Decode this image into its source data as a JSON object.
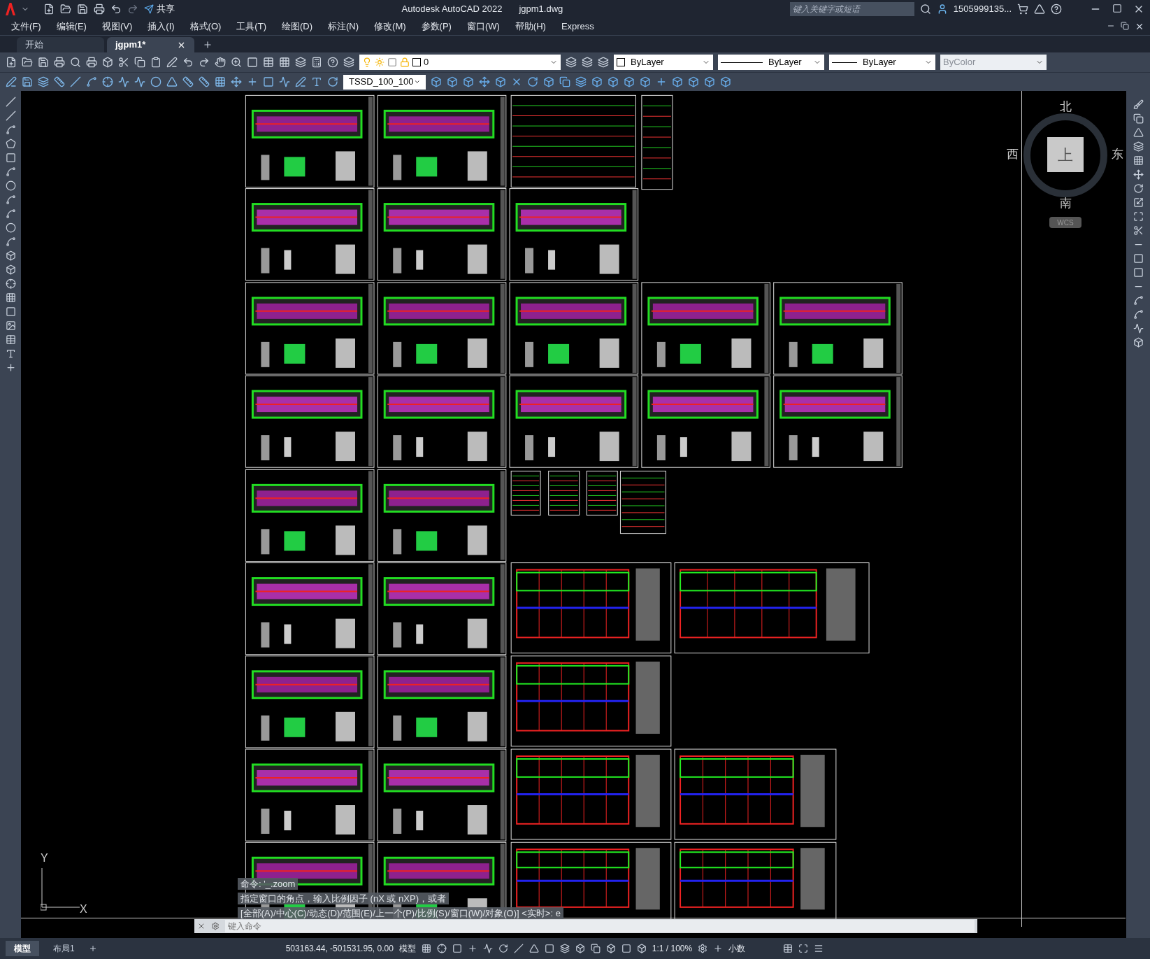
{
  "window": {
    "title": "Autodesk AutoCAD 2022",
    "file": "jgpm1.dwg",
    "share": "共享"
  },
  "search": {
    "placeholder": "键入关键字或短语"
  },
  "user": "1505999135...",
  "menu": [
    "文件(F)",
    "编辑(E)",
    "视图(V)",
    "插入(I)",
    "格式(O)",
    "工具(T)",
    "绘图(D)",
    "标注(N)",
    "修改(M)",
    "参数(P)",
    "窗口(W)",
    "帮助(H)",
    "Express"
  ],
  "file_tabs": [
    {
      "label": "开始",
      "selected": false
    },
    {
      "label": "jgpm1*",
      "selected": true
    }
  ],
  "layer": {
    "name": "0"
  },
  "text_style": {
    "value": "TSSD_100_100"
  },
  "properties": [
    {
      "kind": "color",
      "value": "ByLayer",
      "disabled": false
    },
    {
      "kind": "line",
      "value": "ByLayer",
      "disabled": false
    },
    {
      "kind": "line",
      "value": "ByLayer",
      "disabled": false
    },
    {
      "kind": "plain",
      "value": "ByColor",
      "disabled": true
    }
  ],
  "viewcube": {
    "north": "北",
    "east": "东",
    "south": "南",
    "west": "西",
    "face": "上",
    "ucs": "WCS"
  },
  "ucs_axes": {
    "y": "Y",
    "x": "X"
  },
  "command": {
    "history": [
      "命令: '_.zoom",
      "指定窗口的角点，输入比例因子 (nX 或 nXP)，或者",
      "[全部(A)/中心(C)/动态(D)/范围(E)/上一个(P)/比例(S)/窗口(W)/对象(O)] <实时>:  e"
    ],
    "placeholder": "键入命令"
  },
  "layout_tabs": [
    {
      "label": "模型",
      "selected": true
    },
    {
      "label": "布局1",
      "selected": false
    }
  ],
  "status_bar": {
    "coordinates": "503163.44, -501531.95, 0.00",
    "space": "模型",
    "scale": "1:1 / 100%",
    "units": "小数"
  }
}
